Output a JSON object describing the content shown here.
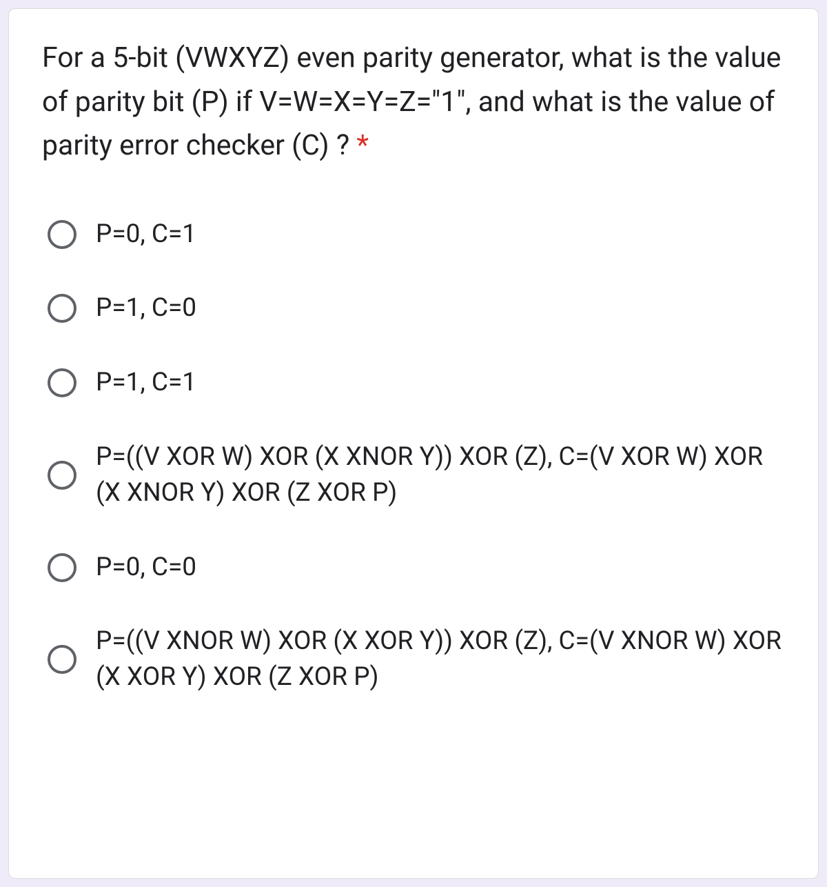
{
  "question": {
    "text": "For a 5-bit (VWXYZ) even parity generator, what is the value of parity bit (P) if V=W=X=Y=Z=\"1\", and what is the value of parity error checker (C) ? ",
    "required_mark": "*"
  },
  "options": [
    {
      "label": "P=0, C=1"
    },
    {
      "label": "P=1, C=0"
    },
    {
      "label": "P=1, C=1"
    },
    {
      "label": "P=((V XOR W) XOR (X XNOR Y)) XOR (Z), C=(V XOR W) XOR (X XNOR Y) XOR (Z XOR P)"
    },
    {
      "label": "P=0, C=0"
    },
    {
      "label": "P=((V XNOR W) XOR (X XOR Y)) XOR (Z), C=(V XNOR W) XOR (X XOR Y) XOR (Z XOR P)"
    }
  ]
}
